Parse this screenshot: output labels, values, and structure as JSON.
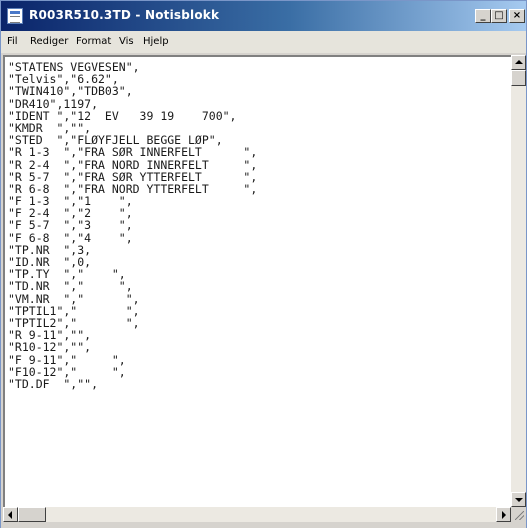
{
  "window": {
    "title": "R003R510.3TD - Notisblokk",
    "controls": {
      "minimize": "_",
      "maximize": "□",
      "close": "×"
    }
  },
  "menu": [
    {
      "label": "Fil"
    },
    {
      "label": "Rediger"
    },
    {
      "label": "Format"
    },
    {
      "label": "Vis"
    },
    {
      "label": "Hjelp"
    }
  ],
  "document": {
    "lines": [
      "\"STATENS VEGVESEN\",",
      "\"Telvis\",\"6.62\",",
      "\"TWIN410\",\"TDB03\",",
      "\"DR410\",1197,",
      "\"IDENT \",\"12  EV   39 19    700\",",
      "\"KMDR  \",\"\",",
      "\"STED  \",\"FLØYFJELL BEGGE LØP\",",
      "\"R 1-3  \",\"FRA SØR INNERFELT      \",",
      "\"R 2-4  \",\"FRA NORD INNERFELT     \",",
      "\"R 5-7  \",\"FRA SØR YTTERFELT      \",",
      "\"R 6-8  \",\"FRA NORD YTTERFELT     \",",
      "\"F 1-3  \",\"1    \",",
      "\"F 2-4  \",\"2    \",",
      "\"F 5-7  \",\"3    \",",
      "\"F 6-8  \",\"4    \",",
      "\"TP.NR  \",3,",
      "\"ID.NR  \",0,",
      "\"TP.TY  \",\"    \",",
      "\"TD.NR  \",\"     \",",
      "\"VM.NR  \",\"      \",",
      "\"TPTIL1\",\"       \",",
      "\"TPTIL2\",\"       \",",
      "\"R 9-11\",\"\",",
      "\"R10-12\",\"\",",
      "\"F 9-11\",\"     \",",
      "\"F10-12\",\"     \",",
      "\"TD.DF  \",\"\","
    ]
  }
}
